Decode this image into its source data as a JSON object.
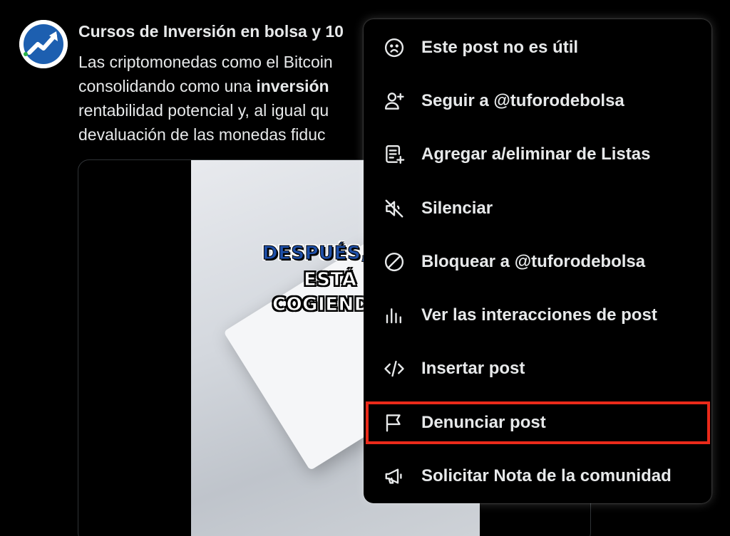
{
  "post": {
    "author": "Cursos de Inversión en bolsa y 10",
    "text_lines": [
      "Las criptomonedas como el Bitcoin",
      "consolidando como una ",
      "rentabilidad potencial y, al igual qu",
      "devaluación de las monedas fiduc"
    ],
    "bold_word": "inversión",
    "media_overlay": [
      "DESPUÉS,",
      "ESTÁ",
      "COGIEND"
    ]
  },
  "menu": {
    "items": [
      {
        "label": "Este post no es útil",
        "icon": "frown-face-icon"
      },
      {
        "label": "Seguir a @tuforodebolsa",
        "icon": "follow-user-icon"
      },
      {
        "label": "Agregar a/eliminar de Listas",
        "icon": "list-add-icon"
      },
      {
        "label": "Silenciar",
        "icon": "mute-icon"
      },
      {
        "label": "Bloquear a @tuforodebolsa",
        "icon": "block-icon"
      },
      {
        "label": "Ver las interacciones de post",
        "icon": "analytics-icon"
      },
      {
        "label": "Insertar post",
        "icon": "code-embed-icon"
      },
      {
        "label": "Denunciar post",
        "icon": "flag-icon"
      },
      {
        "label": "Solicitar Nota de la comunidad",
        "icon": "megaphone-icon"
      }
    ]
  },
  "colors": {
    "background": "#000000",
    "text": "#e7e9ea",
    "highlight": "#ea2a1a"
  }
}
